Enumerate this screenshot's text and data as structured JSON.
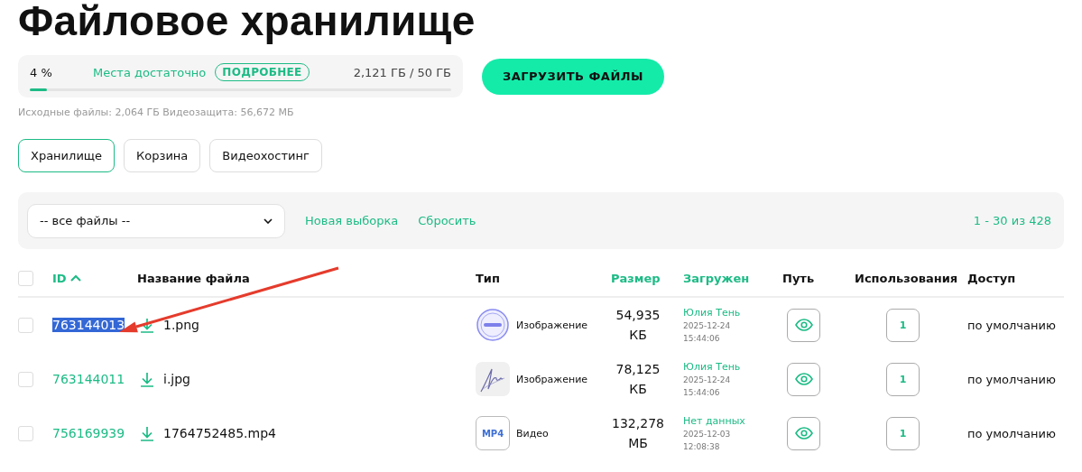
{
  "title": "Файловое хранилище",
  "storage": {
    "percent": "4 %",
    "level": 0.04,
    "status": "Места достаточно",
    "details_button": "ПОДРОБНЕЕ",
    "usage": "2,121 ГБ / 50 ГБ",
    "breakdown": "Исходные файлы: 2,064 ГБ Видеозащита: 56,672 МБ"
  },
  "upload_button": "ЗАГРУЗИТЬ ФАЙЛЫ",
  "tabs": [
    {
      "label": "Хранилище",
      "selected": true
    },
    {
      "label": "Корзина",
      "selected": false
    },
    {
      "label": "Видеохостинг",
      "selected": false
    }
  ],
  "filter": {
    "select_value": "-- все файлы --",
    "links": [
      "Новая выборка",
      "Сбросить"
    ],
    "pagination": "1 - 30 из 428"
  },
  "table": {
    "select_all_checked": false,
    "columns": [
      {
        "label": "ID",
        "sortable": true,
        "sorted_ascending": true
      },
      {
        "label": "Название файла",
        "sortable": false
      },
      {
        "label": "Тип",
        "sortable": false
      },
      {
        "label": "Размер",
        "sortable": true
      },
      {
        "label": "Загружен",
        "sortable": true
      },
      {
        "label": "Путь",
        "sortable": false
      },
      {
        "label": "Использования",
        "sortable": false
      },
      {
        "label": "Доступ",
        "sortable": false
      }
    ],
    "rows": [
      {
        "checked": false,
        "id": "763144013",
        "id_highlighted": true,
        "name": "1.png",
        "thumb": {
          "kind": "stamp"
        },
        "type": "Изображение",
        "size": [
          "54,935",
          "КБ"
        ],
        "uploader": "Юлия Тень",
        "date": "2025-12-24",
        "time": "15:44:06",
        "uses": "1",
        "access": "по умолчанию"
      },
      {
        "checked": false,
        "id": "763144011",
        "id_highlighted": false,
        "name": "i.jpg",
        "thumb": {
          "kind": "signature"
        },
        "type": "Изображение",
        "size": [
          "78,125",
          "КБ"
        ],
        "uploader": "Юлия Тень",
        "date": "2025-12-24",
        "time": "15:44:06",
        "uses": "1",
        "access": "по умолчанию"
      },
      {
        "checked": false,
        "id": "756169939",
        "id_highlighted": false,
        "name": "1764752485.mp4",
        "thumb": {
          "kind": "label",
          "text": "MP4"
        },
        "type": "Видео",
        "size": [
          "132,278",
          "МБ"
        ],
        "uploader": "Нет данных",
        "date": "2025-12-03",
        "time": "12:08:38",
        "uses": "1",
        "access": "по умолчанию"
      }
    ]
  },
  "annotation": {
    "kind": "arrow",
    "color": "#e53b2c"
  }
}
